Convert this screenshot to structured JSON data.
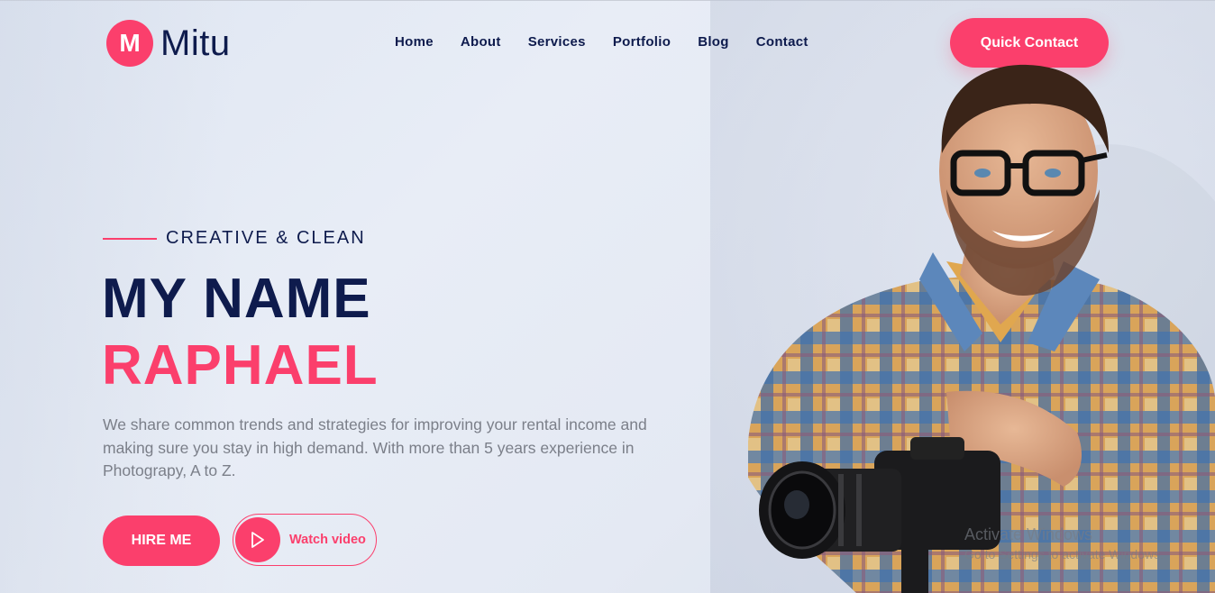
{
  "brand": {
    "logo_letter": "M",
    "name": "Mitu"
  },
  "nav": {
    "items": [
      "Home",
      "About",
      "Services",
      "Portfolio",
      "Blog",
      "Contact"
    ]
  },
  "header": {
    "cta_label": "Quick Contact"
  },
  "hero": {
    "tagline": "CREATIVE & CLEAN",
    "title_line1": "MY NAME",
    "title_line2": "RAPHAEL",
    "description": "We share common trends and strategies for improving your rental income and making sure you stay in high demand. With more than 5 years experience in Photograpy, A to Z.",
    "hire_label": "HIRE ME",
    "video_label": "Watch video"
  },
  "watermark": {
    "line1": "Activate Windows",
    "line2": "Go to Settings to activate Windows."
  },
  "colors": {
    "accent": "#fb3f6c",
    "navy": "#0e1b4d",
    "muted": "#7b7f89"
  }
}
